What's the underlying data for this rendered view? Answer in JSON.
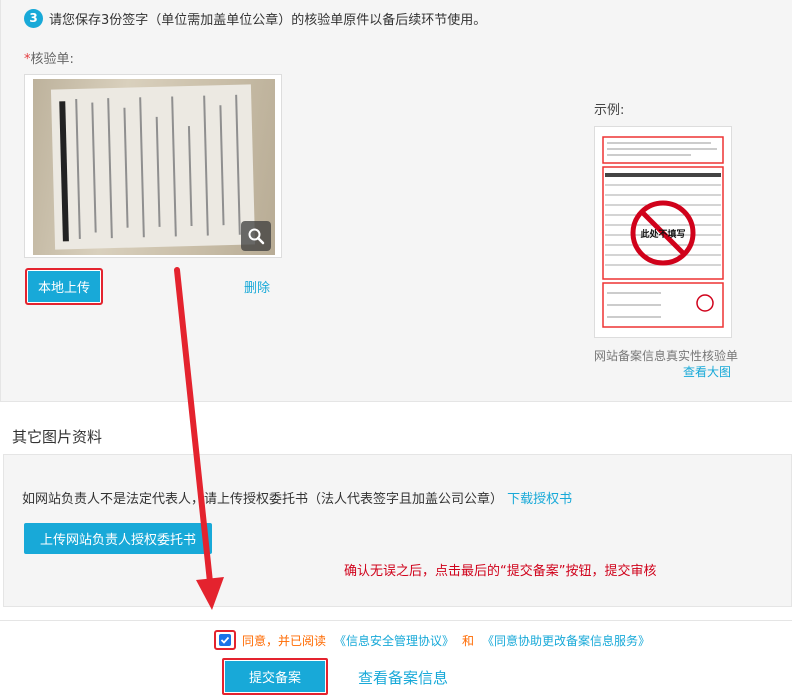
{
  "step": {
    "number": "3",
    "text": "请您保存3份签字（单位需加盖单位公章）的核验单原件以备后续环节使用。"
  },
  "upload_section": {
    "required_mark": "*",
    "label": "核验单:",
    "upload_button": "本地上传",
    "delete_link": "删除"
  },
  "example": {
    "label": "示例:",
    "doc_stamp": "此处不填写",
    "caption": "网站备案信息真实性核验单",
    "view_large_link": "查看大图"
  },
  "other_section": {
    "title": "其它图片资料",
    "text": "如网站负责人不是法定代表人，请上传授权委托书（法人代表签字且加盖公司公章）",
    "download_link": "下载授权书",
    "upload_button": "上传网站负责人授权委托书"
  },
  "annotation": "确认无误之后，点击最后的“提交备案”按钮，提交审核",
  "agreement": {
    "checked": true,
    "text": "同意，并已阅读",
    "link1": "《信息安全管理协议》",
    "and": "和",
    "link2": "《同意协助更改备案信息服务》"
  },
  "actions": {
    "submit": "提交备案",
    "view_info": "查看备案信息"
  },
  "colors": {
    "accent": "#18a9d8",
    "highlight_red": "#e4232e",
    "agree_orange": "#ff6a00"
  }
}
